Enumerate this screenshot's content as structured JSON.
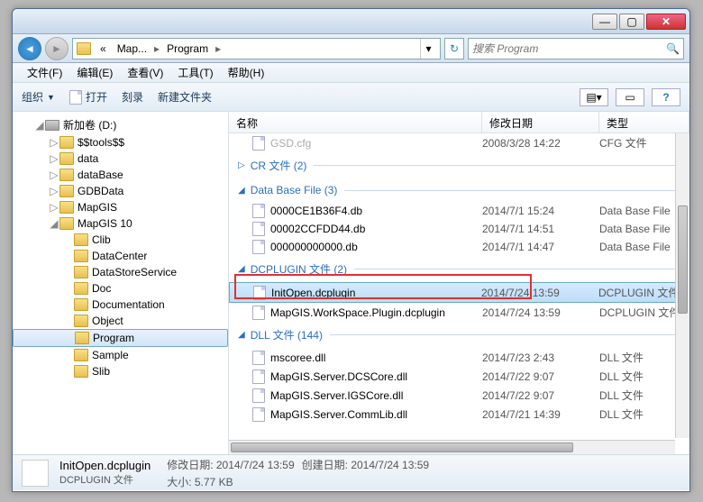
{
  "titlebar": {
    "min": "—",
    "max": "▢",
    "close": "✕"
  },
  "nav": {
    "back_icon": "◄",
    "fwd_icon": "►"
  },
  "breadcrumbs": {
    "prefix": "«",
    "items": [
      "Map...",
      "Program"
    ],
    "sep": "▸"
  },
  "search": {
    "placeholder": "搜索 Program",
    "icon": "🔍"
  },
  "menu": [
    "文件(F)",
    "编辑(E)",
    "查看(V)",
    "工具(T)",
    "帮助(H)"
  ],
  "toolbar": {
    "organize": "组织",
    "open": "打开",
    "burn": "刻录",
    "newfolder": "新建文件夹",
    "view_icon": "▤",
    "help_icon": "?"
  },
  "columns": {
    "name": "名称",
    "date": "修改日期",
    "type": "类型"
  },
  "tree": {
    "root": "新加卷 (D:)",
    "items": [
      "$$tools$$",
      "data",
      "dataBase",
      "GDBData",
      "MapGIS"
    ],
    "expanded": "MapGIS 10",
    "children": [
      "Clib",
      "DataCenter",
      "DataStoreService",
      "Doc",
      "Documentation",
      "Object",
      "Program",
      "Sample",
      "Slib"
    ],
    "selected": "Program"
  },
  "groups": [
    {
      "name": "",
      "collapsed": false,
      "files": [
        {
          "name": "GSD.cfg",
          "date": "2008/3/28 14:22",
          "type": "CFG 文件",
          "faded": true
        }
      ]
    },
    {
      "name": "CR 文件 (2)",
      "collapsed": true,
      "files": []
    },
    {
      "name": "Data Base File (3)",
      "collapsed": false,
      "files": [
        {
          "name": "0000CE1B36F4.db",
          "date": "2014/7/1 15:24",
          "type": "Data Base File"
        },
        {
          "name": "00002CCFDD44.db",
          "date": "2014/7/1 14:51",
          "type": "Data Base File"
        },
        {
          "name": "000000000000.db",
          "date": "2014/7/1 14:47",
          "type": "Data Base File"
        }
      ]
    },
    {
      "name": "DCPLUGIN 文件 (2)",
      "collapsed": false,
      "files": [
        {
          "name": "InitOpen.dcplugin",
          "date": "2014/7/24 13:59",
          "type": "DCPLUGIN 文件",
          "selected": true
        },
        {
          "name": "MapGIS.WorkSpace.Plugin.dcplugin",
          "date": "2014/7/24 13:59",
          "type": "DCPLUGIN 文件"
        }
      ]
    },
    {
      "name": "DLL 文件 (144)",
      "collapsed": false,
      "files": [
        {
          "name": "mscoree.dll",
          "date": "2014/7/23 2:43",
          "type": "DLL 文件"
        },
        {
          "name": "MapGIS.Server.DCSCore.dll",
          "date": "2014/7/22 9:07",
          "type": "DLL 文件"
        },
        {
          "name": "MapGIS.Server.IGSCore.dll",
          "date": "2014/7/22 9:07",
          "type": "DLL 文件"
        },
        {
          "name": "MapGIS.Server.CommLib.dll",
          "date": "2014/7/21 14:39",
          "type": "DLL 文件"
        }
      ]
    }
  ],
  "status": {
    "filename": "InitOpen.dcplugin",
    "filetype": "DCPLUGIN 文件",
    "moddate_label": "修改日期:",
    "moddate": "2014/7/24 13:59",
    "size_label": "大小:",
    "size": "5.77 KB",
    "createdate_label": "创建日期:",
    "createdate": "2014/7/24 13:59"
  }
}
